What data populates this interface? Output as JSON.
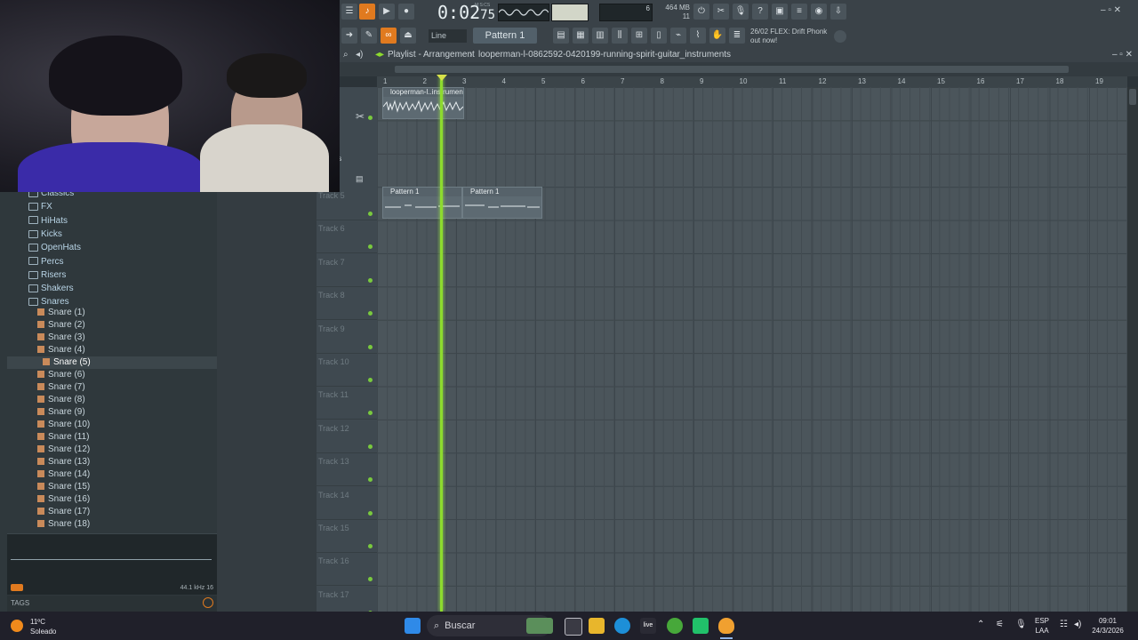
{
  "toolbar": {
    "time_main": "0:02",
    "time_frac": "75",
    "time_unit": "M:S:CS",
    "memory": "464 MB",
    "cpu_value": "6",
    "voices": "11",
    "snap_label": "Line",
    "pattern_label": "Pattern 1",
    "news_line1": "26/02  FLEX: Drift Phonk",
    "news_line2": "out now!"
  },
  "playlist": {
    "title": "Playlist - Arrangement",
    "breadcrumb_sep": "›",
    "audio_name": "looperman-l-0862592-0420199-running-spirit-guitar_instruments",
    "ruler": [
      "1",
      "2",
      "3",
      "4",
      "5",
      "6",
      "7",
      "8",
      "9",
      "10",
      "11",
      "12",
      "13",
      "14",
      "15",
      "16",
      "17",
      "18",
      "19"
    ],
    "track_labels": [
      "Track 5",
      "Track 6",
      "Track 7",
      "Track 8",
      "Track 9",
      "Track 10",
      "Track 11",
      "Track 12",
      "Track 13",
      "Track 14",
      "Track 15",
      "Track 16",
      "Track 17"
    ],
    "instruments_label": "uments",
    "clip_audio_label": "looperman-l..instrumen",
    "clip_pattern_a": "Pattern 1",
    "clip_pattern_b": "Pattern 1"
  },
  "browser": {
    "folders": [
      "Classics",
      "FX",
      "HiHats",
      "Kicks",
      "OpenHats",
      "Percs",
      "Risers",
      "Shakers",
      "Snares"
    ],
    "files": [
      "Snare (1)",
      "Snare (2)",
      "Snare (3)",
      "Snare (4)",
      "Snare (5)",
      "Snare (6)",
      "Snare (7)",
      "Snare (8)",
      "Snare (9)",
      "Snare (10)",
      "Snare (11)",
      "Snare (12)",
      "Snare (13)",
      "Snare (14)",
      "Snare (15)",
      "Snare (16)",
      "Snare (17)",
      "Snare (18)"
    ],
    "selected_file": "Snare (5)",
    "sample_info": "44.1 kHz 16",
    "tags_label": "TAGS"
  },
  "taskbar": {
    "weather_temp": "11ºC",
    "weather_desc": "Soleado",
    "search_label": "Buscar",
    "lang_line1": "ESP",
    "lang_line2": "LAA",
    "time": "09:01",
    "date": "24/3/2026"
  },
  "colors": {
    "accent": "#e07a1f",
    "playhead": "#8ddb2e",
    "track_dot": "#79c93e"
  }
}
